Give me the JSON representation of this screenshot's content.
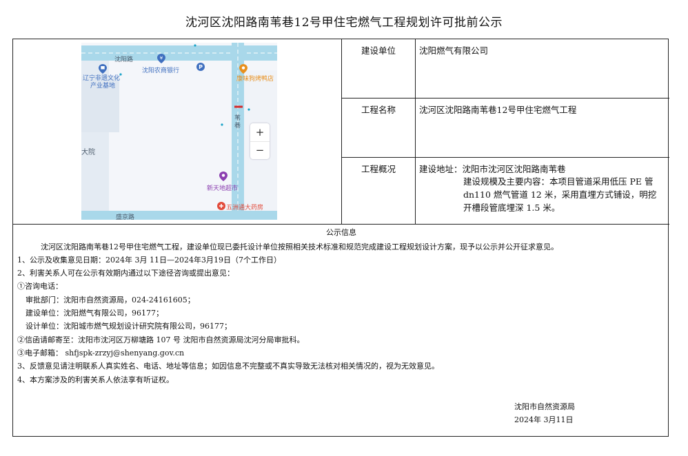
{
  "title": "沈河区沈阳路南苇巷12号甲住宅燃气工程规划许可批前公示",
  "map": {
    "labels": {
      "road_top": "沈阳路",
      "library": "辽宁非遗文化",
      "library2": "产业基地",
      "bank": "沈阳农商银行",
      "restaurant": "康味狗烤鸭店",
      "alley": "苇",
      "alley2": "巷",
      "dayuan": "大院",
      "supermarket": "新天地超市",
      "pharmacy": "五洲通大药房",
      "road_bottom": "盛京路"
    },
    "zoom_in": "+",
    "zoom_out": "−",
    "icons": [
      "library-pin-icon",
      "bank-pin-icon",
      "parking-icon",
      "restaurant-pin-icon",
      "supermarket-pin-icon",
      "pharmacy-pin-icon"
    ]
  },
  "rows": {
    "unit": {
      "label": "建设单位",
      "value": "沈阳燃气有限公司"
    },
    "name": {
      "label": "工程名称",
      "value": "沈河区沈阳路南苇巷12号甲住宅燃气工程"
    },
    "overview": {
      "label": "工程概况",
      "address": "建设地址：沈阳市沈河区沈阳路南苇巷",
      "scope1": "建设规模及主要内容：本项目管道采用低压 PE 管",
      "scope2": "dn110 燃气管道 12 米，采用直埋方式铺设，明挖",
      "scope3": "开槽段管底埋深 1.5 米。"
    }
  },
  "notice": {
    "header": "公示信息",
    "intro": "沈河区沈阳路南苇巷12号甲住宅燃气工程，建设单位现已委托设计单位按照相关技术标准和规范完成建设工程规划设计方案，现予以公示并公开征求意见。",
    "item1": "1、公示及收集意见日期：2024年  3月  11日—2024年3月19日（7个工作日）",
    "item2": "2、利害关系人可在公示有效期内通过以下途径咨询或提出意见：",
    "phone_head": "①咨询电话：",
    "phone1": "审批部门：沈阳市自然资源局，024-24161605；",
    "phone2": "建设单位：沈阳燃气有限公司，96177；",
    "phone3": "设计单位：沈阳城市燃气规划设计研究院有限公司，96177；",
    "mail": "②信函请邮寄至：沈阳市沈河区万柳塘路 107 号 沈阳市自然资源局沈河分局审批科。",
    "email": "③电子邮箱： shfjspk-zrzyj@shenyang.gov.cn",
    "item3": "3、反馈意见请注明联系人真实姓名、电话、地址等信息；如因信息不完整或不真实导致无法核对相关情况的，视为无效意见。",
    "item4": "4、本方案涉及的利害关系人依法享有听证权。",
    "issuer": "沈阳市自然资源局",
    "date": "2024年  3月11日"
  },
  "colors": {
    "road": "#9fd3e6",
    "road_edge": "#6fb8d6",
    "building": "#e6edf5",
    "pin_blue": "#3f6fbf",
    "pin_purple": "#8b3fb0",
    "pin_red": "#e24b3b",
    "restaurant_text": "#e8901f"
  }
}
